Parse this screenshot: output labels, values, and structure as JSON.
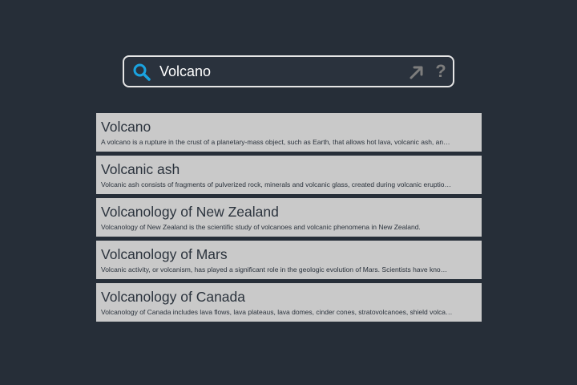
{
  "search": {
    "value": "Volcano",
    "search_icon": "search-icon",
    "open_icon": "arrow-up-right-icon",
    "help_icon": "help-question-icon",
    "help_label": "?"
  },
  "results": [
    {
      "title": "Volcano",
      "snippet": "A volcano is a rupture in the crust of a planetary-mass object, such as Earth, that allows hot lava, volcanic ash, an…"
    },
    {
      "title": "Volcanic ash",
      "snippet": "Volcanic ash consists of fragments of pulverized rock, minerals and volcanic glass, created during volcanic eruptio…"
    },
    {
      "title": "Volcanology of New Zealand",
      "snippet": "Volcanology of New Zealand is the scientific study of volcanoes and volcanic phenomena in New Zealand."
    },
    {
      "title": "Volcanology of Mars",
      "snippet": "Volcanic activity, or volcanism, has played a significant role in the geologic evolution of Mars. Scientists have kno…"
    },
    {
      "title": "Volcanology of Canada",
      "snippet": "Volcanology of Canada includes lava flows, lava plateaus, lava domes, cinder cones, stratovolcanoes, shield volca…"
    }
  ],
  "colors": {
    "background": "#262e38",
    "accent": "#1aa3e0",
    "result_bg": "#c9c9c9",
    "text_dark": "#2b333d"
  }
}
